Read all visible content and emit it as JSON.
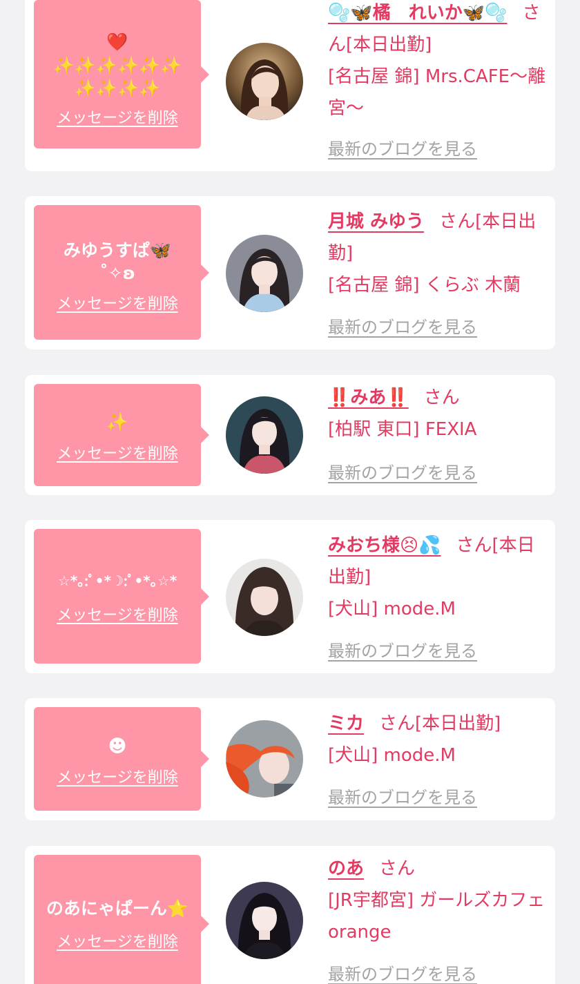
{
  "delete_label": "メッセージを削除",
  "blog_label": "最新のブログを見る",
  "colors": {
    "background": "#f2f2f4",
    "card": "#ffffff",
    "bubble": "#ff96a8",
    "accent_text": "#e33a61",
    "link_gray": "#a3a3a3"
  },
  "entries": [
    {
      "message": "❤️\n✨✨✨✨✨✨\n✨✨✨✨",
      "name": "🫧🦋橘　れいか🦋🫧",
      "honorific": "さん",
      "status": "[本日出勤]",
      "shop": "[名古屋 錦] Mrs.CAFE〜離宮〜",
      "avatar_icon": "portrait-photo"
    },
    {
      "message": "みゆうすぱ🦋\n˚✧ʚ",
      "name": "月城 みゆう",
      "honorific": "さん",
      "status": "[本日出勤]",
      "shop": "[名古屋 錦] くらぶ 木蘭",
      "avatar_icon": "portrait-photo"
    },
    {
      "message": "✨",
      "name": "‼️みあ‼️",
      "honorific": "さん",
      "status": "",
      "shop": "[柏駅 東口] FEXIA",
      "avatar_icon": "portrait-photo"
    },
    {
      "message": "☆*｡:ﾟ•*☽:ﾟ•*｡☆*",
      "name": "みおち様😣💦",
      "honorific": "さん",
      "status": "[本日出勤]",
      "shop": "[犬山] mode.M",
      "avatar_icon": "portrait-photo"
    },
    {
      "message": "☻",
      "name": "ミカ",
      "honorific": "さん",
      "status": "[本日出勤]",
      "shop": "[犬山] mode.M",
      "avatar_icon": "portrait-photo"
    },
    {
      "message": "のあにゃぱーん⭐️",
      "name": "のあ",
      "honorific": "さん",
      "status": "",
      "shop": "[JR宇都宮] ガールズカフェ orange",
      "avatar_icon": "portrait-photo"
    }
  ]
}
